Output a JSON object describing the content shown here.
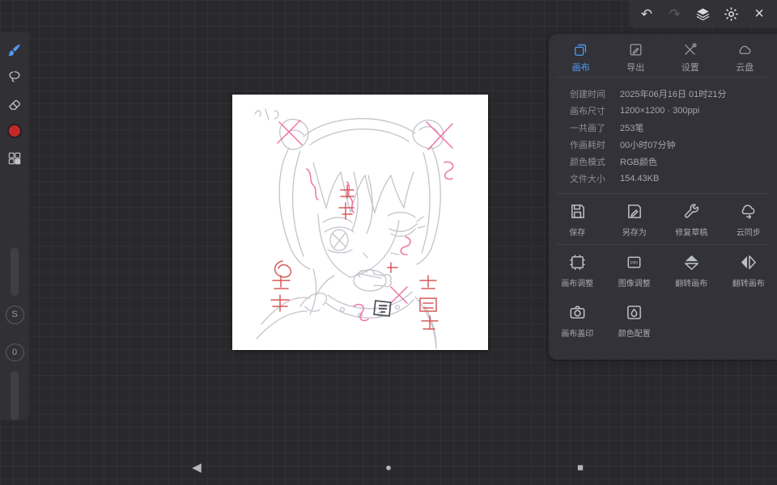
{
  "topbar": {
    "undo_icon": "↶",
    "redo_icon": "↷",
    "close_icon": "×"
  },
  "left_toolbar": {
    "stabilizer_label": "S",
    "value_label": "0"
  },
  "panel": {
    "tabs": [
      {
        "label": "画布",
        "active": true
      },
      {
        "label": "导出",
        "active": false
      },
      {
        "label": "设置",
        "active": false
      },
      {
        "label": "云盘",
        "active": false
      }
    ],
    "info": [
      {
        "label": "创建时间",
        "value": "2025年06月16日 01时21分"
      },
      {
        "label": "画布尺寸",
        "value": "1200×1200 · 300ppi"
      },
      {
        "label": "一共画了",
        "value": "253笔"
      },
      {
        "label": "作画耗时",
        "value": "00小时07分钟"
      },
      {
        "label": "颜色模式",
        "value": "RGB颜色"
      },
      {
        "label": "文件大小",
        "value": "154.43KB"
      }
    ],
    "actions_row1": [
      {
        "label": "保存"
      },
      {
        "label": "另存为"
      },
      {
        "label": "修复草稿"
      },
      {
        "label": "云同步"
      }
    ],
    "actions_row2": [
      {
        "label": "画布调整"
      },
      {
        "label": "图像调整"
      },
      {
        "label": "翻转画布"
      },
      {
        "label": "翻转画布"
      }
    ],
    "actions_row3": [
      {
        "label": "画布盖印"
      },
      {
        "label": "颜色配置"
      }
    ]
  },
  "navbar": {
    "back_icon": "◀",
    "home_icon": "●",
    "recents_icon": "■"
  },
  "colors": {
    "accent": "#4f9cf7",
    "color_swatch": "#c62828",
    "panel_bg": "#323238",
    "background": "#29292c"
  }
}
